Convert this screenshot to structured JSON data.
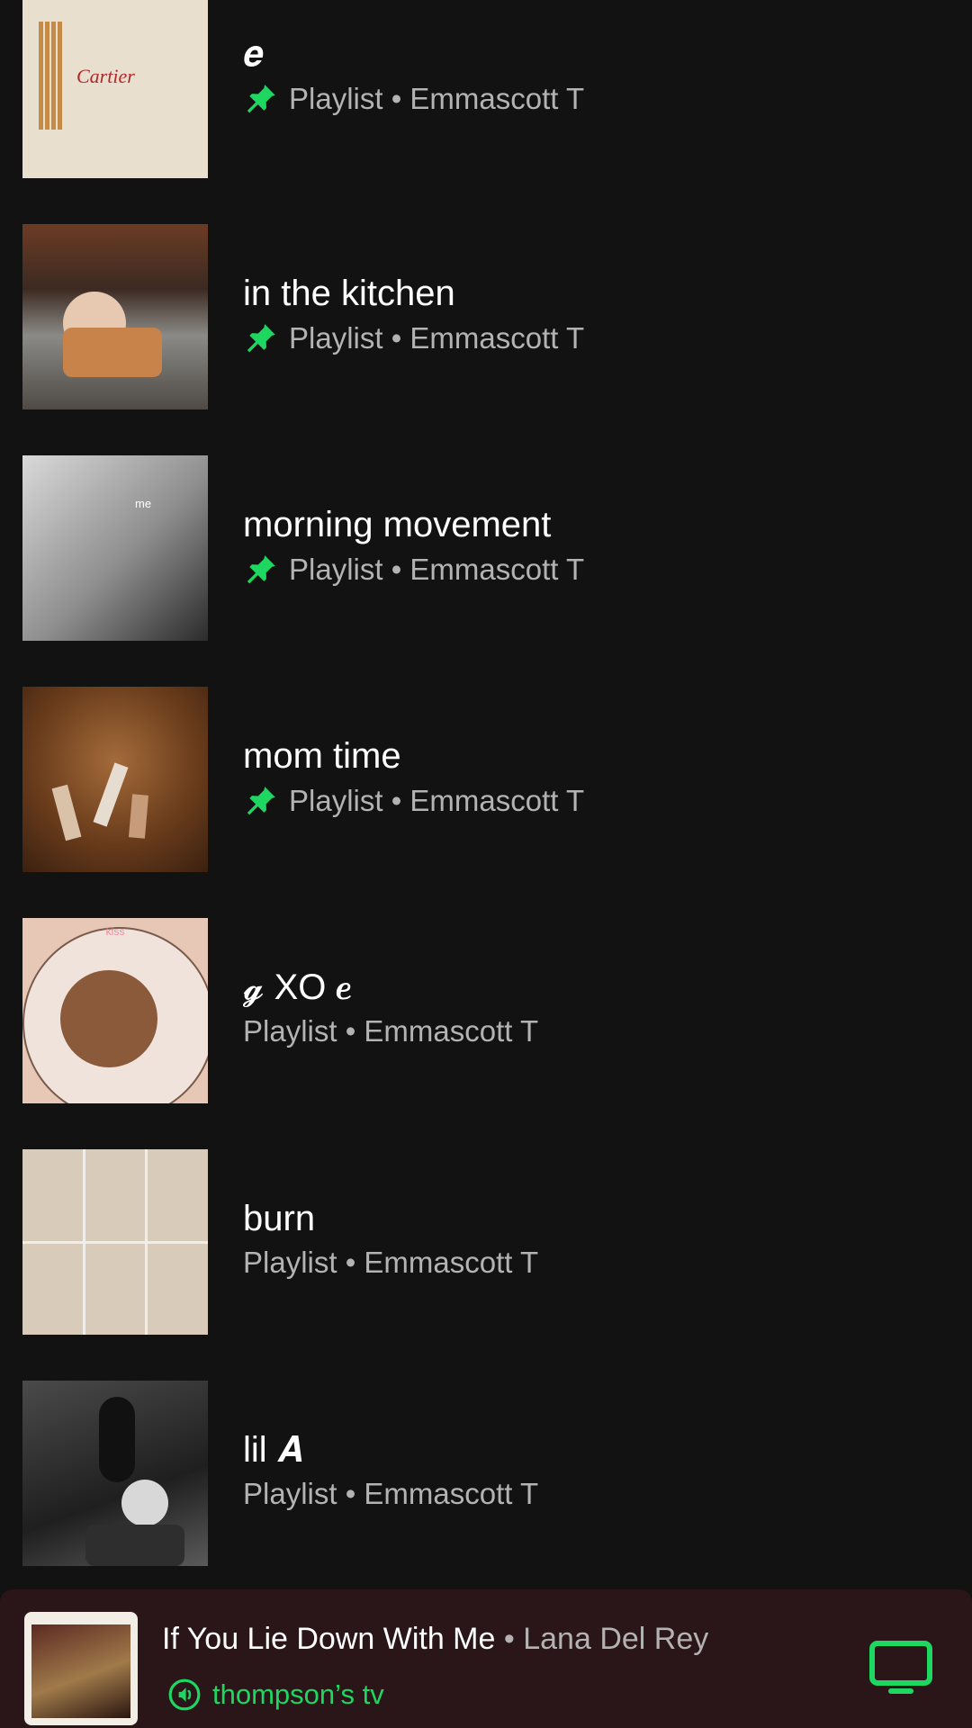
{
  "playlists": [
    {
      "title": "𝒆",
      "subtitle": "Playlist • Emmascott T",
      "pinned": true,
      "art": "cartier"
    },
    {
      "title": "in the kitchen",
      "subtitle": "Playlist • Emmascott T",
      "pinned": true,
      "art": "kitchen"
    },
    {
      "title": "morning movement",
      "subtitle": "Playlist • Emmascott T",
      "pinned": true,
      "art": "morning"
    },
    {
      "title": "mom time",
      "subtitle": "Playlist • Emmascott T",
      "pinned": true,
      "art": "mom"
    },
    {
      "title": "𝓰 XO 𝒆",
      "subtitle": "Playlist • Emmascott T",
      "pinned": false,
      "art": "cookie"
    },
    {
      "title": "burn",
      "subtitle": "Playlist • Emmascott T",
      "pinned": false,
      "art": "burn"
    },
    {
      "title": "lil 𝑨",
      "subtitle": "Playlist • Emmascott T",
      "pinned": false,
      "art": "lil"
    }
  ],
  "art_text": {
    "cartier": "Cartier",
    "cookie": "kiss",
    "morning": "me"
  },
  "now_playing": {
    "track": "If You Lie Down With Me",
    "separator": "•",
    "artist": "Lana Del Rey",
    "device": "thompson’s tv"
  },
  "icons": {
    "pin": "pin-icon",
    "device": "speaker-icon",
    "cast": "tv-icon"
  },
  "colors": {
    "background": "#121212",
    "accent": "#1ed760",
    "secondary_text": "#b3b3b3",
    "player_bg": "#2a1518"
  }
}
